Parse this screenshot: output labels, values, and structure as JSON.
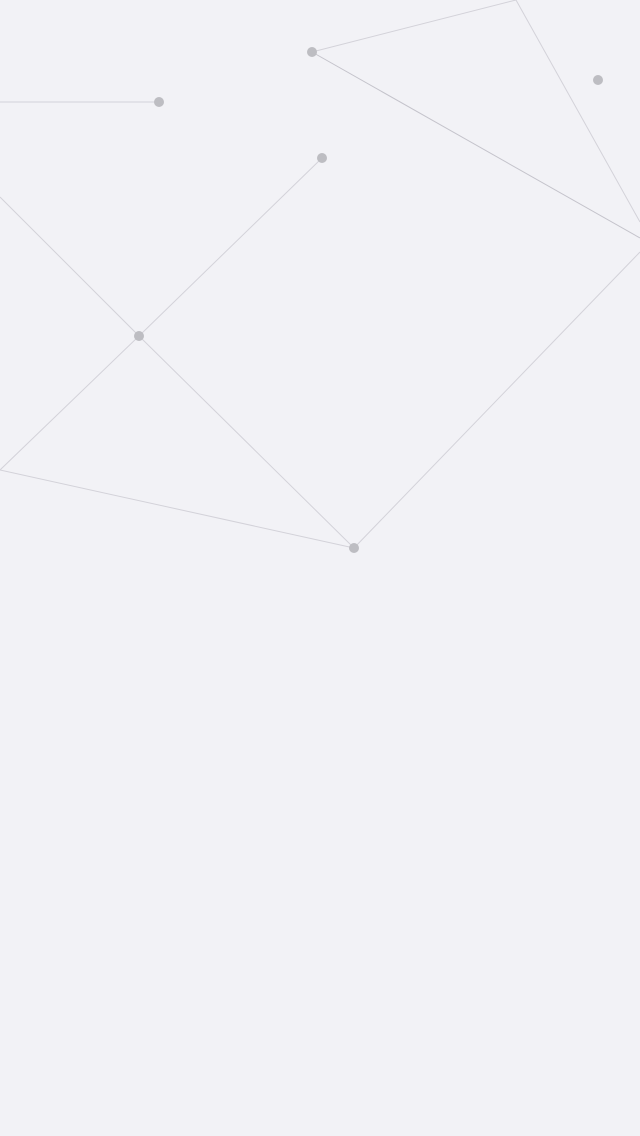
{
  "background_color": "#f2f2f6",
  "line_color": "#d3d2d9",
  "line_color_strong": "#c4c3cb",
  "node_color": "#bdbdc2",
  "node_count": 7,
  "link_count": 9
}
